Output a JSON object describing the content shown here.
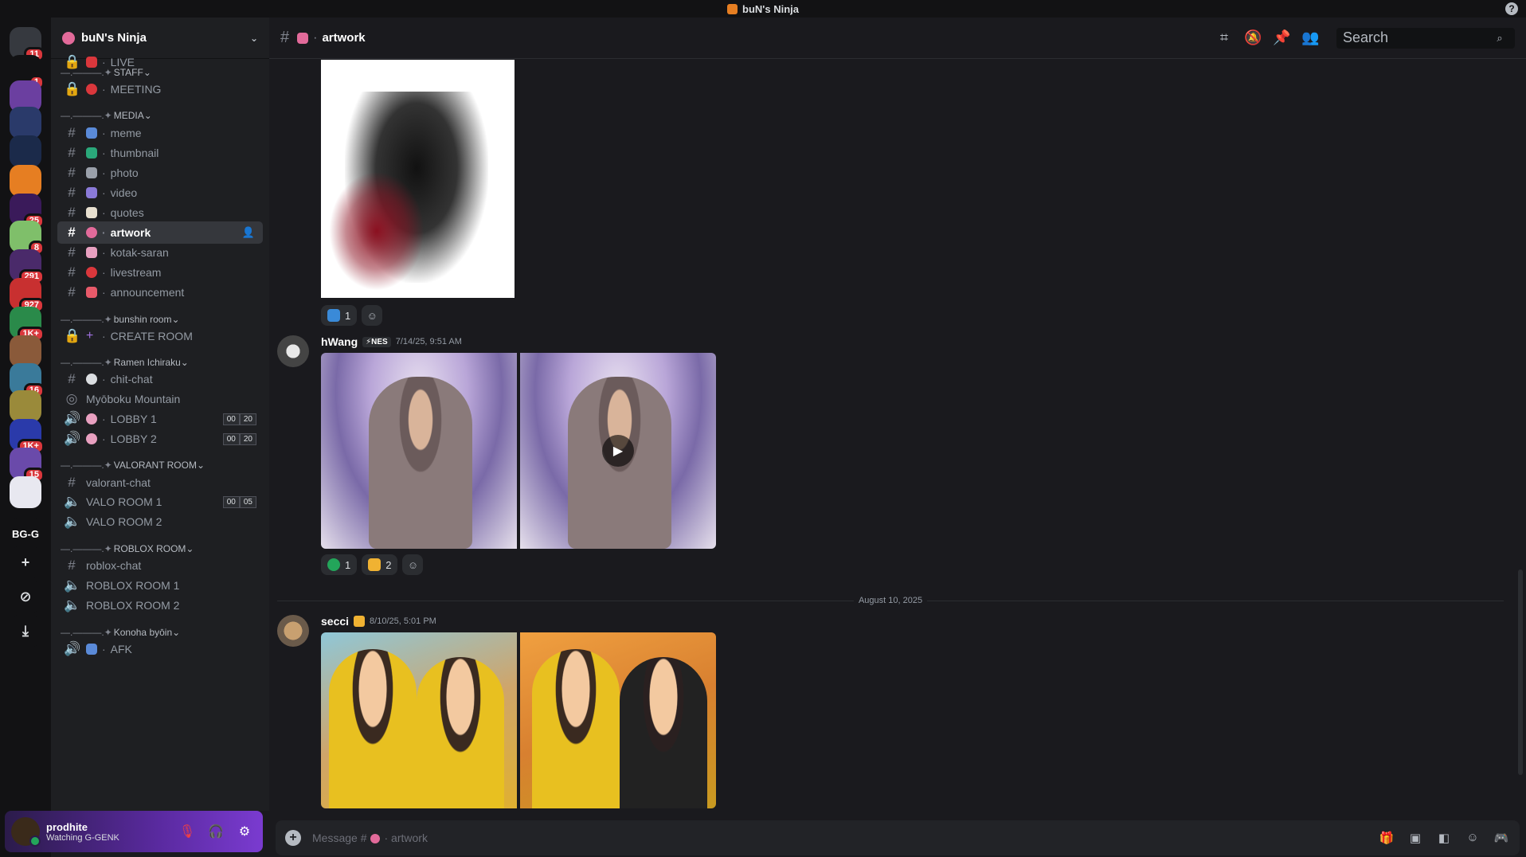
{
  "window": {
    "title": "buN's Ninja",
    "help": "?"
  },
  "servers": [
    {
      "name": "discord-home",
      "badge": "11",
      "color": "#36393f"
    },
    {
      "name": "notifications",
      "badge": "1",
      "color": "#121214"
    },
    {
      "name": "server-phone",
      "badge": "",
      "color": "#6b3fa0"
    },
    {
      "name": "server-game",
      "badge": "",
      "color": "#2a3a6a"
    },
    {
      "name": "server-symbol",
      "badge": "",
      "color": "#1b2a4a"
    },
    {
      "name": "server-bun-ninja",
      "badge": "",
      "color": "#e67e22"
    },
    {
      "name": "server-v",
      "badge": "25",
      "color": "#3a1a5a"
    },
    {
      "name": "server-anime",
      "badge": "8",
      "color": "#7fbf6a"
    },
    {
      "name": "server-stage",
      "badge": "291",
      "color": "#4a2a6a"
    },
    {
      "name": "server-pokemon",
      "badge": "927",
      "color": "#c83030"
    },
    {
      "name": "server-green",
      "badge": "1K+",
      "color": "#2a8a4a"
    },
    {
      "name": "server-photo",
      "badge": "",
      "color": "#8a5a3a"
    },
    {
      "name": "server-mix",
      "badge": "16",
      "color": "#3a7a9a"
    },
    {
      "name": "server-yellow",
      "badge": "",
      "color": "#9a8a3a"
    },
    {
      "name": "server-blue",
      "badge": "1K+",
      "color": "#2a3aaa"
    },
    {
      "name": "server-purple",
      "badge": "15",
      "color": "#6a4aaa"
    },
    {
      "name": "server-light",
      "badge": "",
      "color": "#e8e8f0"
    },
    {
      "name": "server-bgg",
      "badge": "",
      "color": "#121214",
      "text": "BG-G"
    }
  ],
  "guild": {
    "name": "buN's Ninja"
  },
  "categories": [
    {
      "label": "STAFF",
      "prefix": "—.———.✦"
    },
    {
      "label": "MEDIA",
      "prefix": "—.———.✦"
    },
    {
      "label": "bunshin room",
      "prefix": "—.———.✦"
    },
    {
      "label": "Ramen Ichiraku",
      "prefix": "—.———.✦"
    },
    {
      "label": "VALORANT ROOM",
      "prefix": "—.———.✦"
    },
    {
      "label": "ROBLOX ROOM",
      "prefix": "—.———.✦"
    },
    {
      "label": "Konoha byōin",
      "prefix": "—.———.✦"
    }
  ],
  "channels": {
    "live": "LIVE",
    "meeting": "MEETING",
    "meme": "meme",
    "thumbnail": "thumbnail",
    "photo": "photo",
    "video": "video",
    "quotes": "quotes",
    "artwork": "artwork",
    "kotak_saran": "kotak-saran",
    "livestream": "livestream",
    "announcement": "announcement",
    "create_room": "CREATE ROOM",
    "chit_chat": "chit-chat",
    "myoboku": "Myōboku Mountain",
    "lobby1": "LOBBY 1",
    "lobby2": "LOBBY 2",
    "valorant_chat": "valorant-chat",
    "valo1": "VALO ROOM 1",
    "valo2": "VALO ROOM 2",
    "roblox_chat": "roblox-chat",
    "roblox1": "ROBLOX ROOM 1",
    "roblox2": "ROBLOX ROOM 2",
    "afk": "AFK"
  },
  "voice_counts": {
    "lobby1": [
      "00",
      "20"
    ],
    "lobby2": [
      "00",
      "20"
    ],
    "valo1": [
      "00",
      "05"
    ]
  },
  "sep": "·",
  "user": {
    "name": "prodhite",
    "status": "Watching G-GENK"
  },
  "header": {
    "channel": "artwork",
    "search_placeholder": "Search"
  },
  "messages": [
    {
      "reactions": [
        {
          "count": "1",
          "color": "#3a8ad8"
        }
      ]
    },
    {
      "author": "hWang",
      "tag": "⚡NES",
      "time": "7/14/25, 9:51 AM",
      "reactions": [
        {
          "count": "1",
          "color": "#23a55a"
        },
        {
          "count": "2",
          "color": "#f0b232"
        }
      ]
    },
    {
      "author": "secci",
      "time": "8/10/25, 5:01 PM"
    }
  ],
  "date_divider": "August 10, 2025",
  "composer": {
    "placeholder": "Message #",
    "channel": "artwork"
  }
}
